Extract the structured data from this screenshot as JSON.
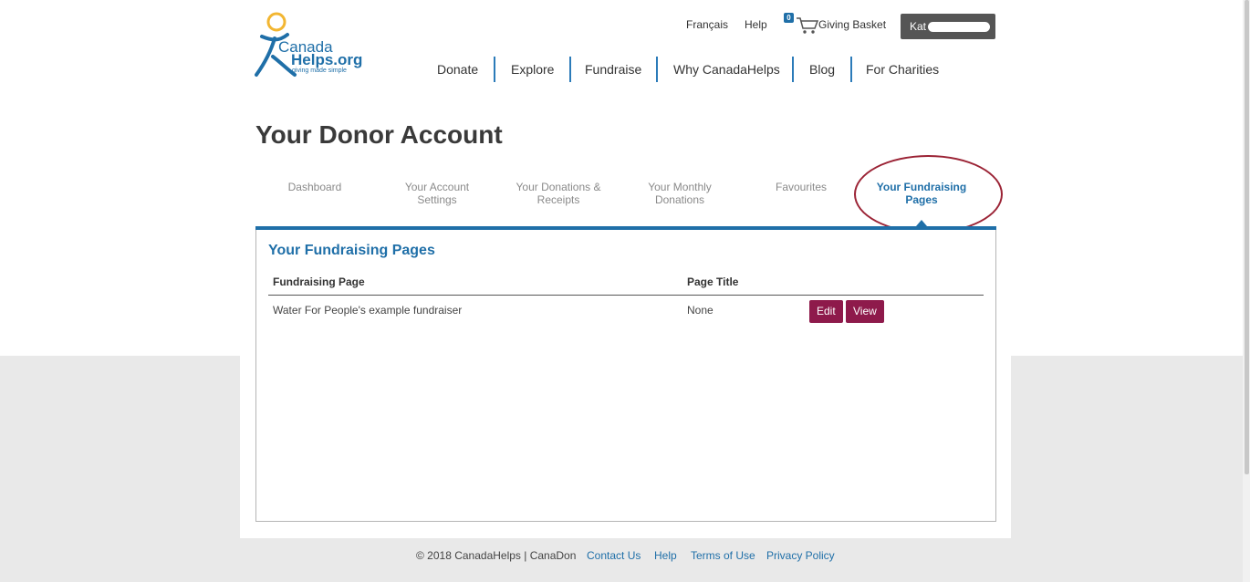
{
  "logo": {
    "line1": "Canada",
    "line2": "Helps.org",
    "tagline": "giving made simple"
  },
  "utility_nav": {
    "language": "Français",
    "help": "Help",
    "basket_count": "0",
    "basket_label": "Giving Basket",
    "user_name": "Kat"
  },
  "main_nav": [
    "Donate",
    "Explore",
    "Fundraise",
    "Why CanadaHelps",
    "Blog",
    "For Charities"
  ],
  "page_title": "Your Donor Account",
  "tabs": [
    {
      "line1": "Dashboard",
      "line2": ""
    },
    {
      "line1": "Your Account",
      "line2": "Settings"
    },
    {
      "line1": "Your Donations &",
      "line2": "Receipts"
    },
    {
      "line1": "Your Monthly",
      "line2": "Donations"
    },
    {
      "line1": "Favourites",
      "line2": ""
    },
    {
      "line1": "Your Fundraising",
      "line2": "Pages",
      "active": true
    }
  ],
  "panel": {
    "title": "Your Fundraising Pages",
    "columns": [
      "Fundraising Page",
      "Page Title"
    ],
    "rows": [
      {
        "page": "Water For People's example fundraiser",
        "title": "None",
        "edit": "Edit",
        "view": "View"
      }
    ]
  },
  "footer": {
    "copyright": "© 2018 CanadaHelps | CanaDon",
    "links": [
      "Contact Us",
      "Help",
      "Terms of Use",
      "Privacy Policy"
    ]
  },
  "colors": {
    "brand_blue": "#1f6fa8",
    "button": "#8e1a4b",
    "highlight_circle": "#9b2335"
  }
}
